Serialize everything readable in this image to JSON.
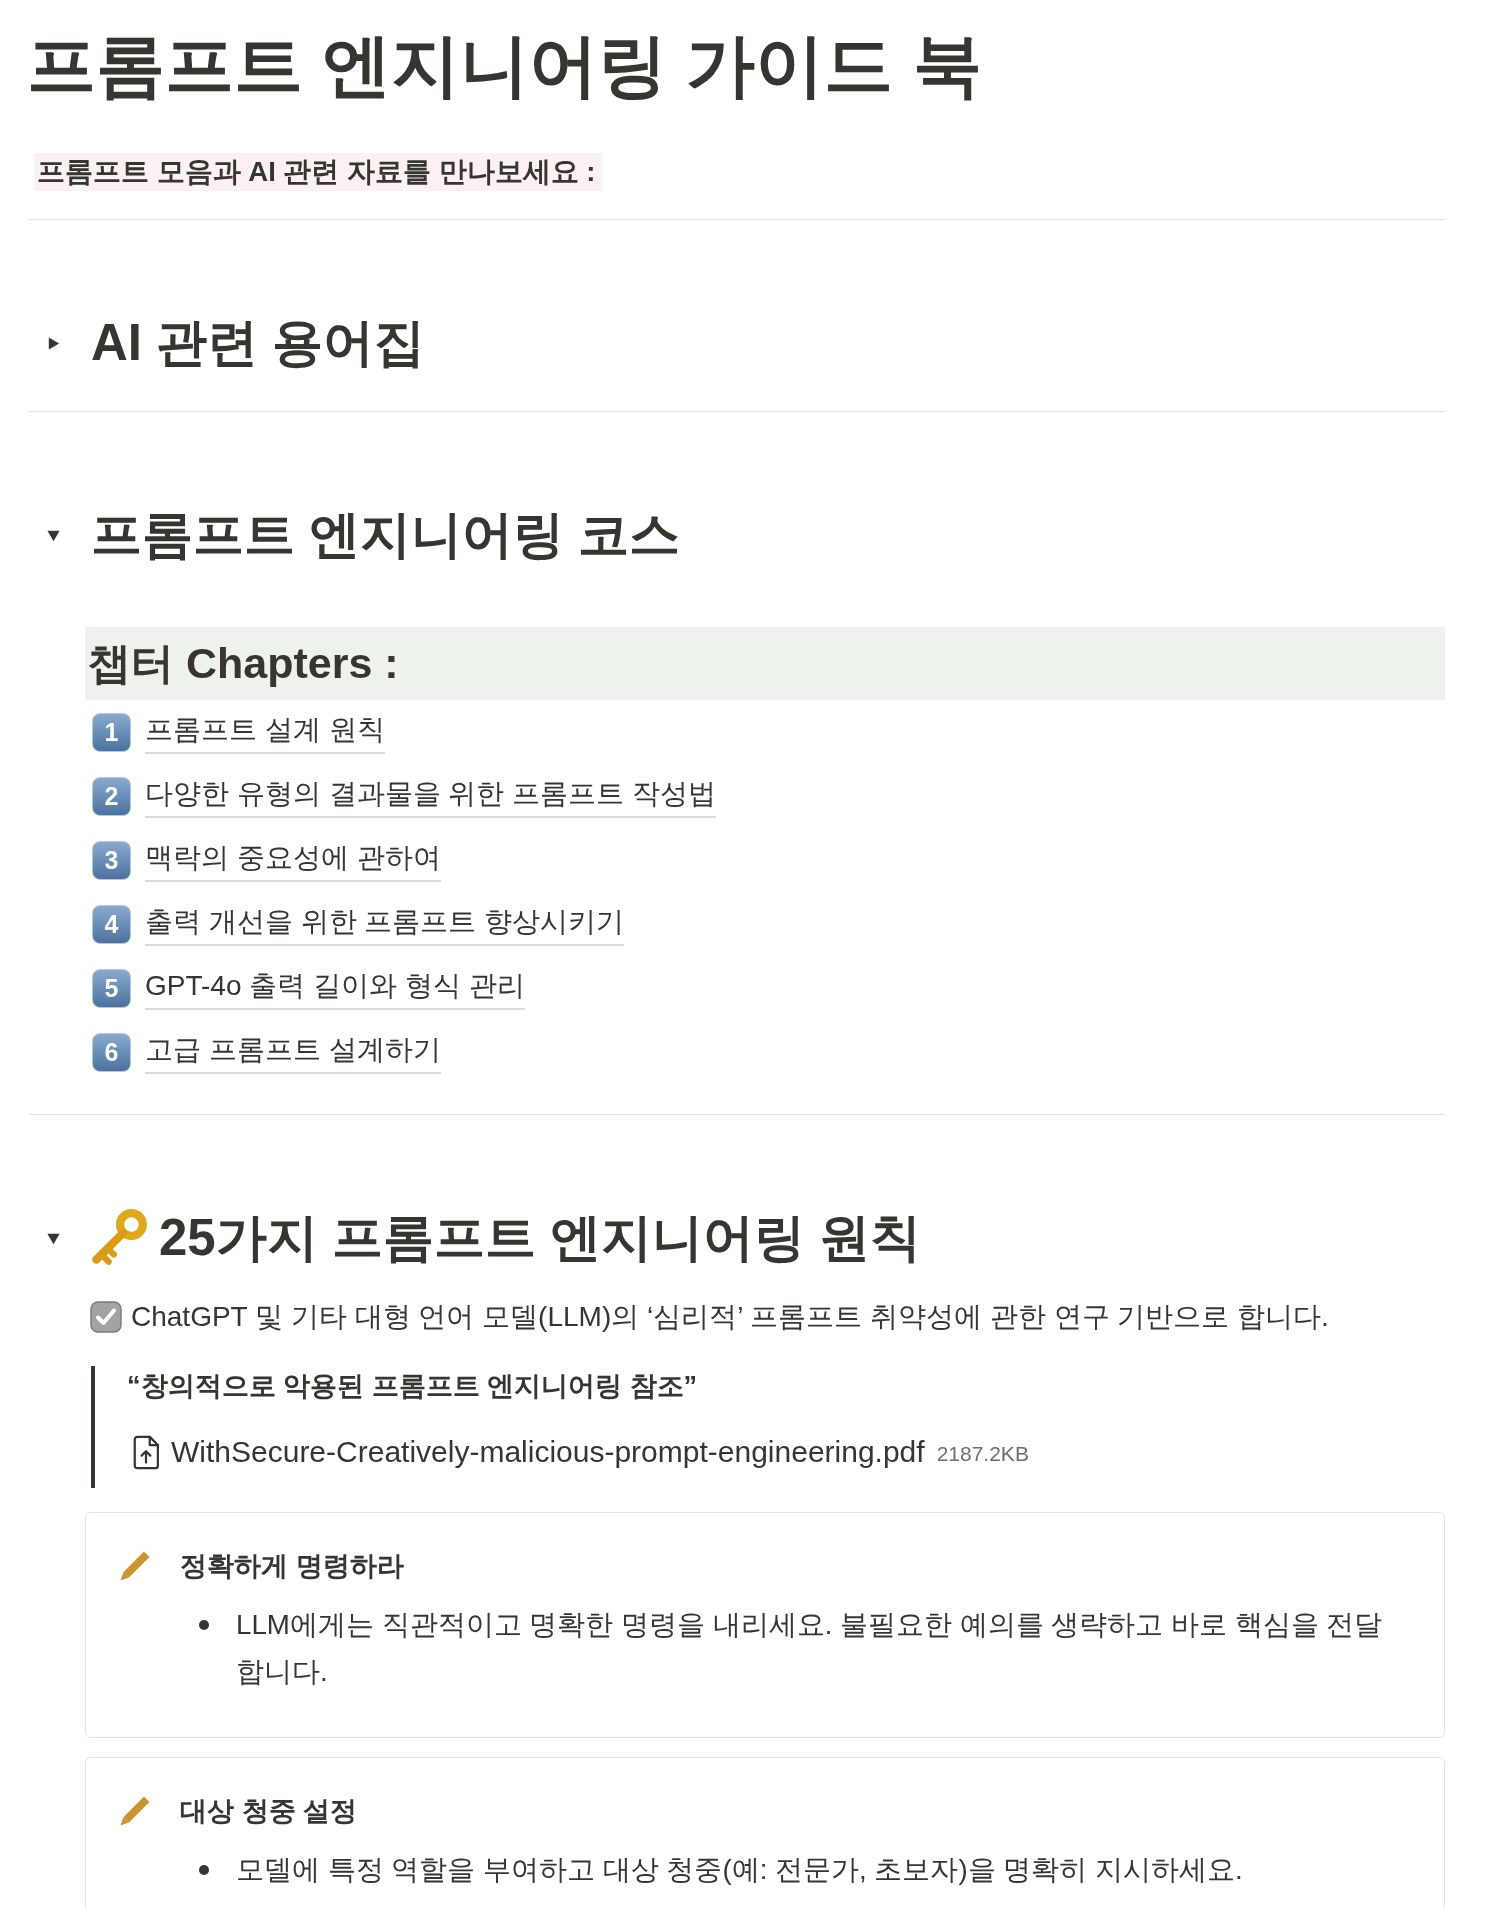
{
  "title": "프롬프트 엔지니어링 가이드 북",
  "subtitle": "프롬프트 모음과 AI 관련 자료를 만나보세요 :",
  "glossary": {
    "heading": "AI 관련 용어집",
    "expanded": false
  },
  "course": {
    "heading": "프롬프트 엔지니어링 코스",
    "expanded": true,
    "chapters_heading": "챕터 Chapters :",
    "chapters": [
      {
        "number": "1",
        "title": "프롬프트 설계 원칙"
      },
      {
        "number": "2",
        "title": "다양한 유형의 결과물을 위한 프롬프트 작성법"
      },
      {
        "number": "3",
        "title": "맥락의 중요성에 관하여"
      },
      {
        "number": "4",
        "title": "출력 개선을 위한 프롬프트 향상시키기"
      },
      {
        "number": "5",
        "title": "GPT-4o 출력 길이와 형식 관리"
      },
      {
        "number": "6",
        "title": "고급 프롬프트 설계하기"
      }
    ]
  },
  "principles": {
    "heading": "25가지 프롬프트 엔지니어링 원칙",
    "expanded": true,
    "note": {
      "checked": true,
      "text": "ChatGPT 및 기타 대형 언어 모델(LLM)의 ‘심리적’ 프롬프트 취약성에 관한 연구 기반으로 합니다."
    },
    "quote": {
      "text": "“창의적으로 악용된 프롬프트 엔지니어링 참조”",
      "file": {
        "name": "WithSecure-Creatively-malicious-prompt-engineering.pdf",
        "size": "2187.2KB"
      }
    },
    "callouts": [
      {
        "title": "정확하게 명령하라",
        "bullets": [
          "LLM에게는 직관적이고 명확한 명령을 내리세요. 불필요한 예의를 생략하고 바로 핵심을 전달합니다."
        ]
      },
      {
        "title": "대상 청중 설정",
        "bullets": [
          "모델에 특정 역할을 부여하고 대상 청중(예: 전문가, 초보자)을 명확히 지시하세요."
        ]
      }
    ]
  }
}
